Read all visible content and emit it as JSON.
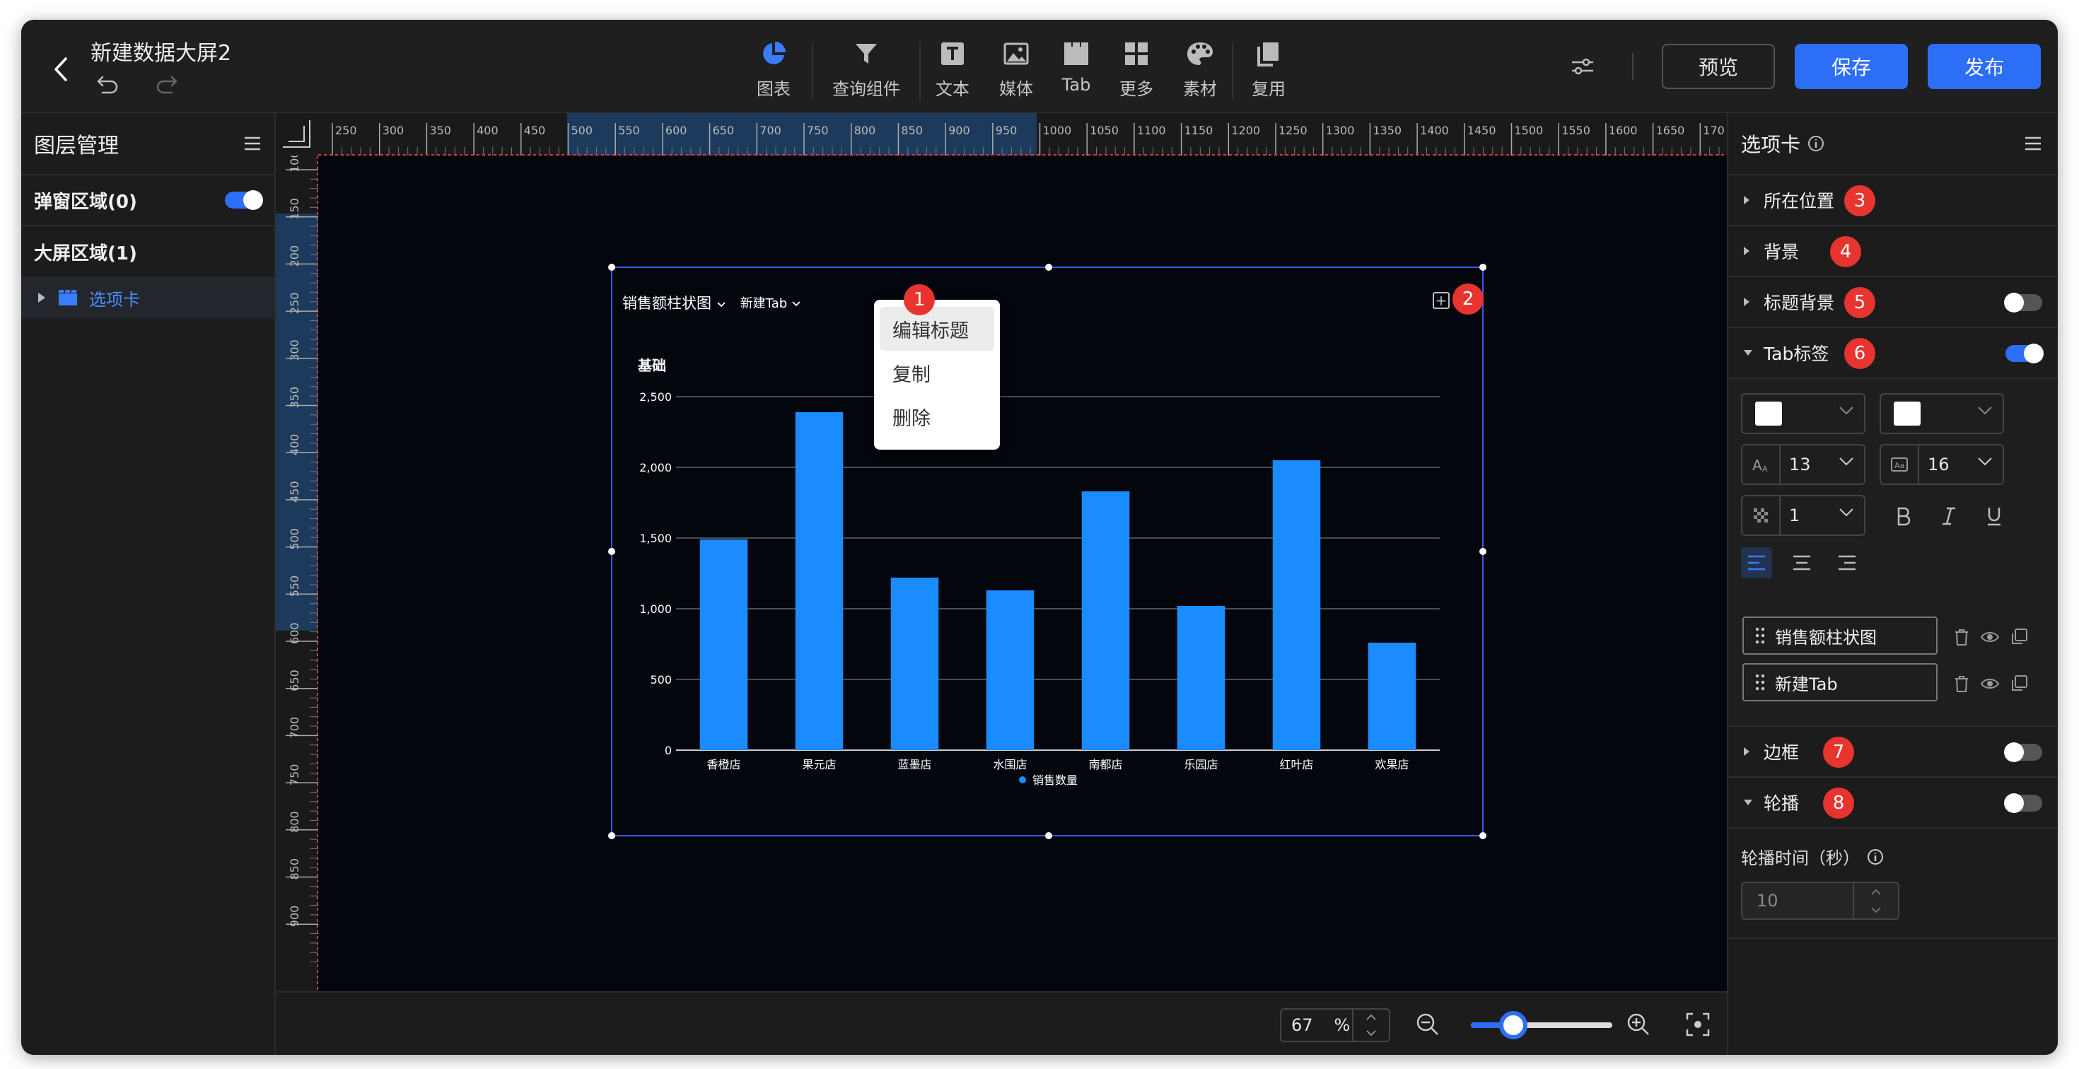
{
  "header": {
    "title": "新建数据大屏2",
    "toolbar": [
      {
        "label": "图表",
        "icon": "pie-chart-icon",
        "active": true
      },
      {
        "label": "查询组件",
        "icon": "filter-icon"
      },
      {
        "label": "文本",
        "icon": "text-icon"
      },
      {
        "label": "媒体",
        "icon": "image-icon"
      },
      {
        "label": "Tab",
        "icon": "tab-icon"
      },
      {
        "label": "更多",
        "icon": "grid-icon"
      },
      {
        "label": "素材",
        "icon": "palette-icon"
      },
      {
        "label": "复用",
        "icon": "copy-icon"
      }
    ],
    "preview_label": "预览",
    "save_label": "保存",
    "publish_label": "发布"
  },
  "left_panel": {
    "title": "图层管理",
    "popup_area": "弹窗区域(0)",
    "screen_area": "大屏区域(1)",
    "layer_item": "选项卡"
  },
  "ruler": {
    "top_ticks": [
      "250",
      "300",
      "350",
      "400",
      "450",
      "500",
      "550",
      "600",
      "650",
      "700",
      "750",
      "800",
      "850",
      "900",
      "950",
      "1000",
      "1050",
      "1100",
      "1150",
      "1200",
      "1250",
      "1300",
      "1350",
      "1400",
      "1450",
      "1500",
      "1550",
      "1600",
      "1650",
      "170"
    ],
    "left_ticks": [
      "100",
      "150",
      "200",
      "250",
      "300",
      "350",
      "400",
      "450",
      "500",
      "550",
      "600",
      "650",
      "700",
      "750",
      "800",
      "850",
      "900"
    ]
  },
  "widget": {
    "tab1": "销售额柱状图",
    "tab2": "新建Tab",
    "chart_title_partial": "基础"
  },
  "context_menu": {
    "items": [
      "编辑标题",
      "复制",
      "删除"
    ]
  },
  "annotations": [
    "1",
    "2",
    "3",
    "4",
    "5",
    "6",
    "7",
    "8"
  ],
  "chart_data": {
    "type": "bar",
    "categories": [
      "香橙店",
      "果元店",
      "蓝墨店",
      "水围店",
      "南都店",
      "乐园店",
      "红叶店",
      "欢果店"
    ],
    "series": [
      {
        "name": "销售数量",
        "values": [
          1490,
          2390,
          1220,
          1130,
          1830,
          1020,
          2050,
          760
        ],
        "color": "#1a8cff"
      }
    ],
    "yticks": [
      "0",
      "500",
      "1,000",
      "1,500",
      "2,000",
      "2,500"
    ],
    "ylim": [
      0,
      2500
    ],
    "grid": true,
    "legend": "bottom"
  },
  "bottom_bar": {
    "zoom_value": "67",
    "zoom_unit": "%",
    "zoom_level": 0.3
  },
  "right_panel": {
    "title": "选项卡",
    "sections": {
      "position": "所在位置",
      "background": "背景",
      "title_bg": "标题背景",
      "tab_label": "Tab标签",
      "border": "边框",
      "carousel": "轮播"
    },
    "font_size": "13",
    "label_size": "16",
    "opacity": "1",
    "tab_items": [
      "销售额柱状图",
      "新建Tab"
    ],
    "carousel_time_label": "轮播时间（秒）",
    "carousel_time_value": "10"
  },
  "colors": {
    "accent": "#2d6ef7",
    "badge": "#e8342f",
    "bar": "#1a8cff"
  }
}
